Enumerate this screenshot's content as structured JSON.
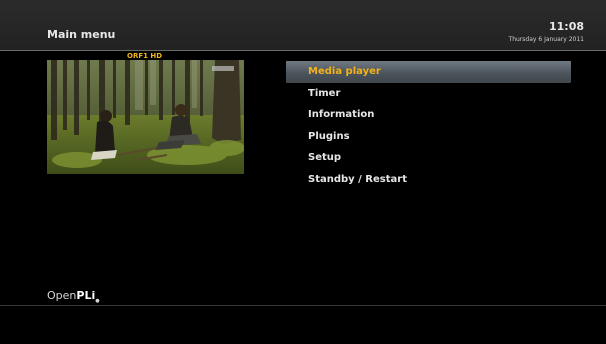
{
  "header": {
    "title": "Main menu",
    "time": "11:08",
    "date": "Thursday 6 January 2011"
  },
  "preview": {
    "channel": "ORF1 HD"
  },
  "menu": {
    "items": [
      {
        "label": "Media player",
        "selected": true
      },
      {
        "label": "Timer"
      },
      {
        "label": "Information"
      },
      {
        "label": "Plugins"
      },
      {
        "label": "Setup"
      },
      {
        "label": "Standby / Restart"
      }
    ]
  },
  "footer": {
    "logo_thin": "Open",
    "logo_bold": "PLi"
  },
  "colors": {
    "accent": "#f2b21a",
    "background": "#000000",
    "header": "#252525"
  }
}
